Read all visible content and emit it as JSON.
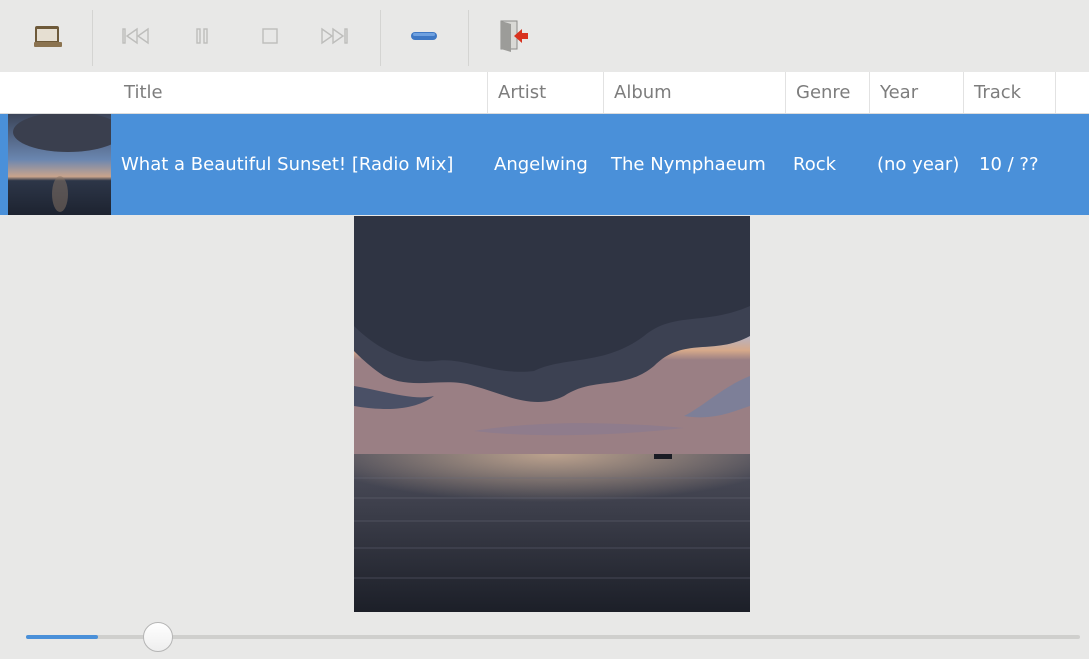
{
  "toolbar": {
    "buttons": [
      {
        "name": "open-file-button",
        "icon": "folder-icon",
        "enabled": true
      },
      {
        "name": "previous-button",
        "icon": "skip-previous-icon",
        "enabled": false
      },
      {
        "name": "pause-button",
        "icon": "pause-icon",
        "enabled": false
      },
      {
        "name": "stop-button",
        "icon": "stop-icon",
        "enabled": false
      },
      {
        "name": "next-button",
        "icon": "skip-next-icon",
        "enabled": false
      },
      {
        "name": "remove-button",
        "icon": "minus-icon",
        "enabled": true
      },
      {
        "name": "quit-button",
        "icon": "exit-door-icon",
        "enabled": true
      }
    ]
  },
  "columns": {
    "title": "Title",
    "artist": "Artist",
    "album": "Album",
    "genre": "Genre",
    "year": "Year",
    "track": "Track"
  },
  "rows": [
    {
      "title": "What a Beautiful Sunset! [Radio Mix]",
      "artist": "Angelwing",
      "album": "The Nymphaeum",
      "genre": "Rock",
      "year": "(no year)",
      "track": "10 / ??",
      "selected": true
    }
  ],
  "playback": {
    "progress": 0.068
  },
  "colors": {
    "accent": "#4a90d9",
    "window_bg": "#e8e8e7",
    "header_bg": "#ffffff"
  }
}
